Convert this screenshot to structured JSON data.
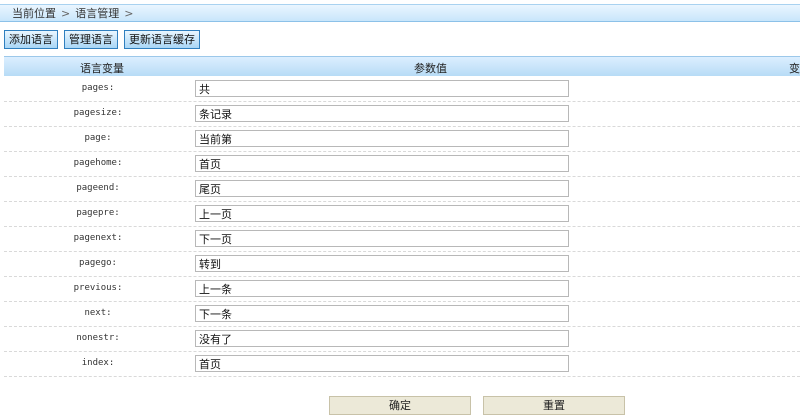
{
  "breadcrumb": {
    "items": [
      "当前位置",
      "语言管理"
    ],
    "sep": ">"
  },
  "toolbar": {
    "buttons": [
      "添加语言",
      "管理语言",
      "更新语言缓存"
    ]
  },
  "table": {
    "headers": {
      "var": "语言变量",
      "value": "参数值",
      "extra": "变"
    },
    "rows": [
      {
        "var": "pages:",
        "value": "共"
      },
      {
        "var": "pagesize:",
        "value": "条记录"
      },
      {
        "var": "page:",
        "value": "当前第"
      },
      {
        "var": "pagehome:",
        "value": "首页"
      },
      {
        "var": "pageend:",
        "value": "尾页"
      },
      {
        "var": "pagepre:",
        "value": "上一页"
      },
      {
        "var": "pagenext:",
        "value": "下一页"
      },
      {
        "var": "pagego:",
        "value": "转到"
      },
      {
        "var": "previous:",
        "value": "上一条"
      },
      {
        "var": "next:",
        "value": "下一条"
      },
      {
        "var": "nonestr:",
        "value": "没有了"
      },
      {
        "var": "index:",
        "value": "首页"
      }
    ]
  },
  "actions": {
    "confirm": "确定",
    "reset": "重置"
  }
}
